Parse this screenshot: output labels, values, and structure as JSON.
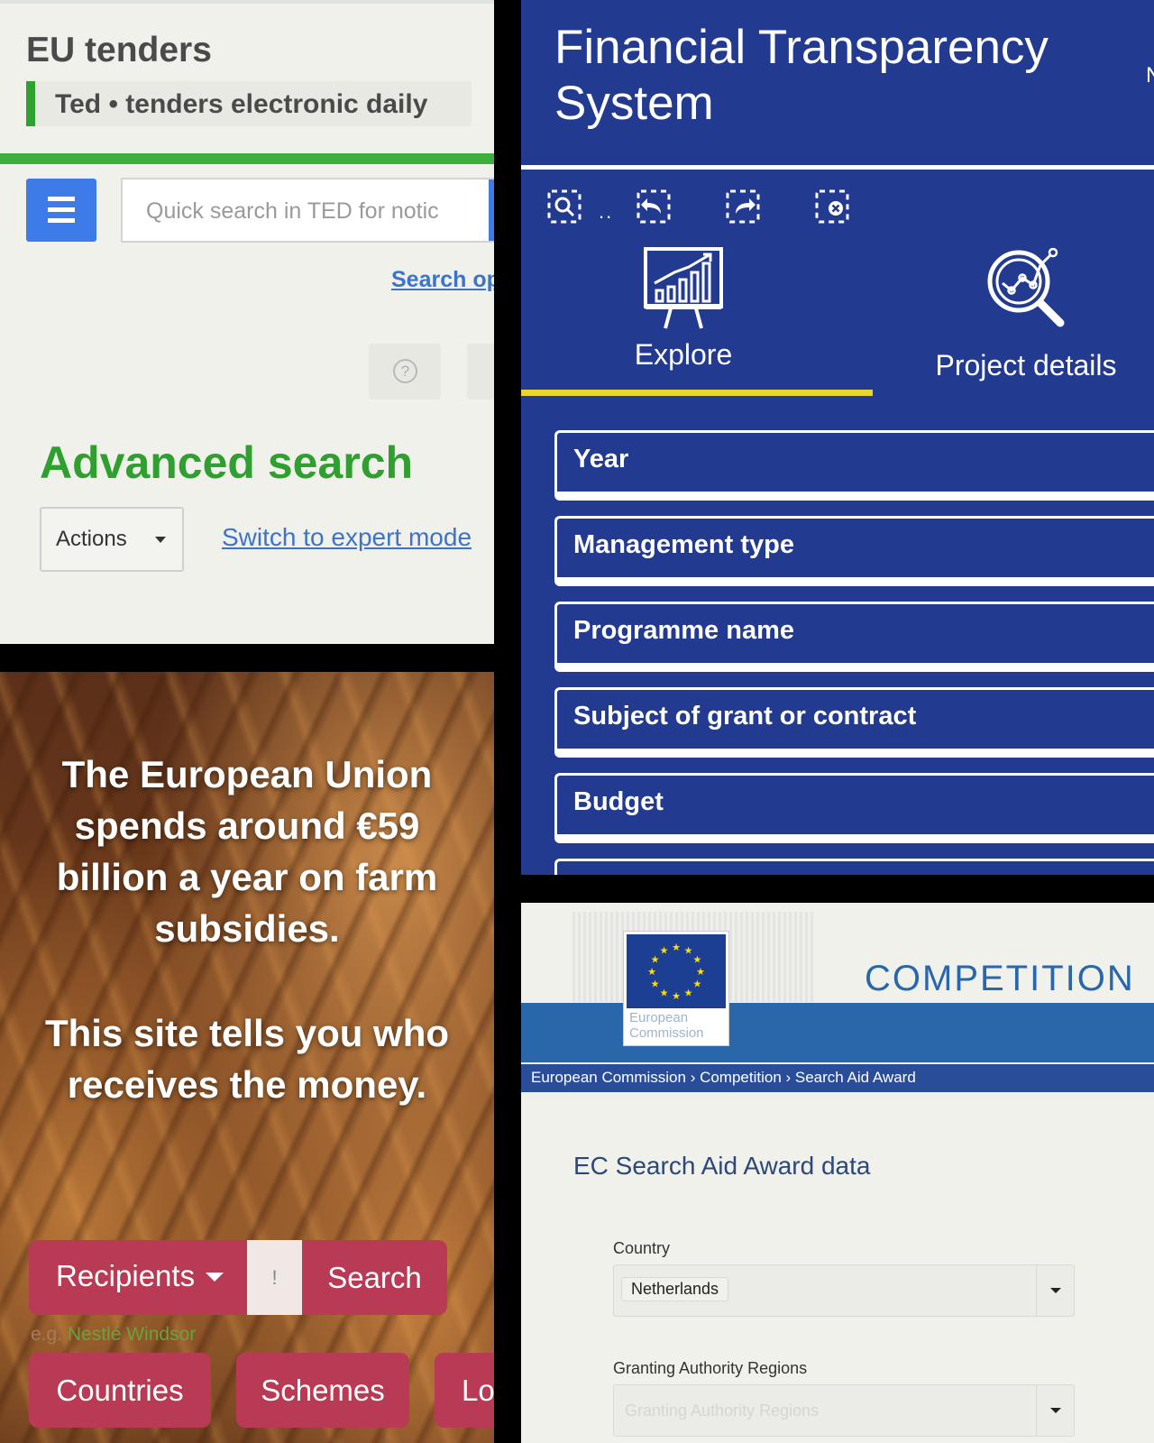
{
  "ted": {
    "site_name": "EU tenders",
    "site_subtitle": "Ted • tenders electronic daily",
    "search_placeholder": "Quick search in TED for notic",
    "search_options_link": "Search op",
    "help_icon": "?",
    "heading": "Advanced search",
    "actions_label": "Actions",
    "expert_mode_link": "Switch to expert mode",
    "colors": {
      "accent_green": "#3eae3e",
      "button_blue": "#3d7ce8",
      "link_blue": "#3d73c9"
    }
  },
  "fts": {
    "title": "Financial Transparency System",
    "edge_letter": "N",
    "toolbar_dots": "..",
    "toolbar_icons": [
      "zoom-selection-icon",
      "undo-selection-icon",
      "redo-selection-icon",
      "clear-selection-icon"
    ],
    "tabs": [
      {
        "label": "Explore",
        "icon": "presentation-chart-icon",
        "active": true
      },
      {
        "label": "Project details",
        "icon": "magnifier-analysis-icon",
        "active": false
      }
    ],
    "filters": [
      "Year",
      "Management type",
      "Programme name",
      "Subject of grant or contract",
      "Budget"
    ],
    "colors": {
      "background": "#223a8f",
      "active_tab": "#e8d62f"
    }
  },
  "farm": {
    "intro": "The European Union spends around €59 billion a year on farm subsidies.",
    "tagline": "This site tells you who receives the money.",
    "dropdown_label": "Recipients",
    "input_stub": "!",
    "search_button": "Search",
    "hint_prefix": "e.g.",
    "hint_examples": "Nestlé  Windsor",
    "nav_buttons": [
      "Countries",
      "Schemes",
      "Lo"
    ],
    "colors": {
      "button": "#b83a55",
      "hint": "#6aa23b"
    }
  },
  "competition": {
    "logo_line1": "European",
    "logo_line2": "Commission",
    "title": "COMPETITION",
    "breadcrumb": "European Commission › Competition › Search Aid Award",
    "heading": "EC Search Aid Award data",
    "country_label": "Country",
    "country_value": "Netherlands",
    "regions_label": "Granting Authority Regions",
    "regions_placeholder": "Granting Authority Regions",
    "colors": {
      "band": "#2a67aa",
      "breadcrumb_bar": "#2a4d9a",
      "heading": "#2c4778"
    }
  }
}
